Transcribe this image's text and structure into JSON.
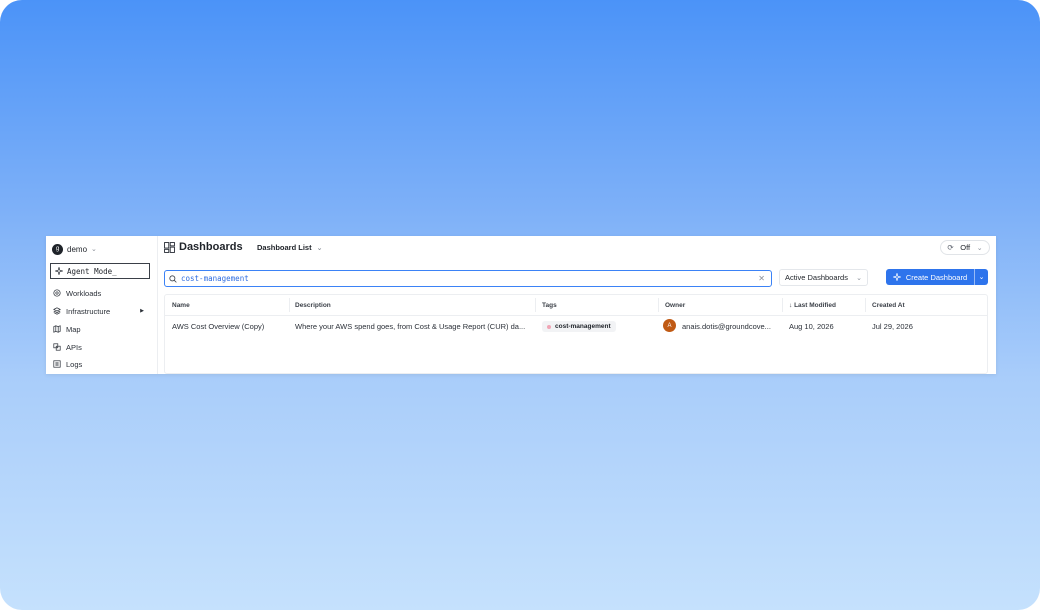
{
  "workspace": {
    "avatar": "g",
    "name": "demo"
  },
  "sidebar": {
    "agent_mode": "Agent Mode_",
    "items": [
      {
        "label": "Workloads",
        "icon": "workloads-icon"
      },
      {
        "label": "Infrastructure",
        "icon": "infrastructure-icon",
        "has_arrow": true
      },
      {
        "label": "Map",
        "icon": "map-icon"
      },
      {
        "label": "APIs",
        "icon": "apis-icon"
      },
      {
        "label": "Logs",
        "icon": "logs-icon"
      }
    ]
  },
  "header": {
    "title": "Dashboards",
    "list_selector": "Dashboard List",
    "refresh_value": "Off"
  },
  "toolbar": {
    "search_value": "cost-management",
    "filter_label": "Active Dashboards",
    "create_label": "Create Dashboard"
  },
  "table": {
    "columns": [
      "Name",
      "Description",
      "Tags",
      "Owner",
      "Last Modified",
      "Created At"
    ],
    "rows": [
      {
        "name": "AWS Cost Overview (Copy)",
        "description": "Where your AWS spend goes, from Cost & Usage Report (CUR) da...",
        "tag": "cost-management",
        "owner_initial": "A",
        "owner": "anais.dotis@groundcove...",
        "last_modified": "Aug 10, 2026",
        "created_at": "Jul 29, 2026"
      }
    ]
  },
  "colors": {
    "accent": "#2e74ec",
    "avatar": "#c05a14",
    "tag_dot": "#f0a5b5"
  }
}
